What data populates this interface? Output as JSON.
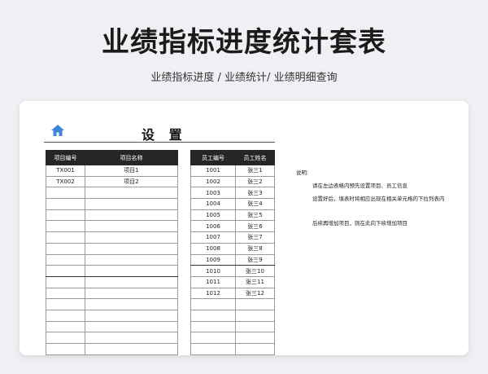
{
  "header": {
    "title": "业绩指标进度统计套表",
    "subtitle": "业绩指标进度  /  业绩统计/  业绩明细查询"
  },
  "sheet": {
    "title": "设 置",
    "home_icon": "home-icon",
    "accent_color": "#3d86d8"
  },
  "projects": {
    "headers": [
      "项目编号",
      "项目名称"
    ],
    "rows": [
      [
        "TX001",
        "项目1"
      ],
      [
        "TX002",
        "项目2"
      ],
      [
        "",
        ""
      ],
      [
        "",
        ""
      ],
      [
        "",
        ""
      ],
      [
        "",
        ""
      ],
      [
        "",
        ""
      ],
      [
        "",
        ""
      ],
      [
        "",
        ""
      ],
      [
        "",
        ""
      ],
      [
        "",
        ""
      ],
      [
        "",
        ""
      ],
      [
        "",
        ""
      ],
      [
        "",
        ""
      ],
      [
        "",
        ""
      ],
      [
        "",
        ""
      ],
      [
        "",
        ""
      ]
    ]
  },
  "employees": {
    "headers": [
      "员工编号",
      "员工姓名"
    ],
    "rows": [
      [
        "1001",
        "张三1"
      ],
      [
        "1002",
        "张三2"
      ],
      [
        "1003",
        "张三3"
      ],
      [
        "1004",
        "张三4"
      ],
      [
        "1005",
        "张三5"
      ],
      [
        "1006",
        "张三6"
      ],
      [
        "1007",
        "张三7"
      ],
      [
        "1008",
        "张三8"
      ],
      [
        "1009",
        "张三9"
      ],
      [
        "1010",
        "张三10"
      ],
      [
        "1011",
        "张三11"
      ],
      [
        "1012",
        "张三12"
      ],
      [
        "",
        ""
      ],
      [
        "",
        ""
      ],
      [
        "",
        ""
      ],
      [
        "",
        ""
      ],
      [
        "",
        ""
      ]
    ]
  },
  "notes": {
    "label": "说明:",
    "lines": [
      "请在左边表格内预先设置项目、员工信息",
      "设置好后，填表时将相应出现在相关单元格的下拉列表内",
      "",
      "后续再增加项目，则在此向下续增加项目"
    ]
  }
}
